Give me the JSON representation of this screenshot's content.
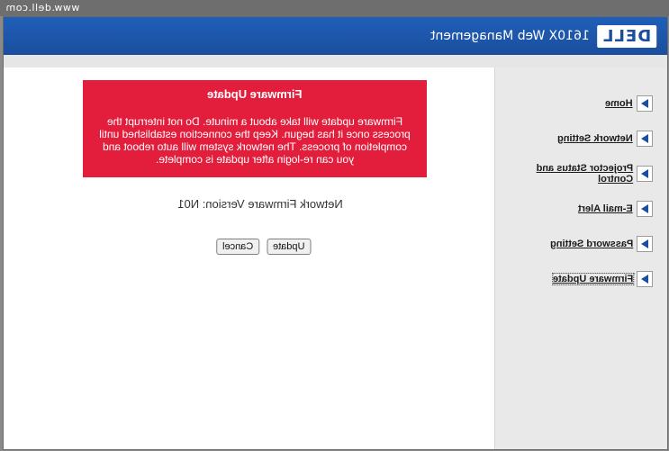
{
  "browser": {
    "url": "www.dell.com"
  },
  "header": {
    "logo_text": "DELL",
    "tm": "™",
    "tagline": "1610X Web Management"
  },
  "alert": {
    "title": "Firmware Update",
    "message": "Firmware update will take about a minute. Do not interrupt the process once it has begun. Keep the connection established until completion of process. The network system will auto reboot and you can re-login after update is complete.",
    "color": "#e21e3c"
  },
  "main": {
    "version_label": "Network Firmware Version: N01",
    "update_label": "Update",
    "cancel_label": "Cancel"
  },
  "sidebar": {
    "items": [
      {
        "label": "Home"
      },
      {
        "label": "Network Setting"
      },
      {
        "label": "Projector Status and Control"
      },
      {
        "label": "E-mail Alert"
      },
      {
        "label": "Password Setting"
      },
      {
        "label": "Firmware Update"
      }
    ],
    "selected_index": 5
  },
  "colors": {
    "header_blue": "#1b4e9e",
    "sidebar_bg": "#e9e9e9"
  }
}
